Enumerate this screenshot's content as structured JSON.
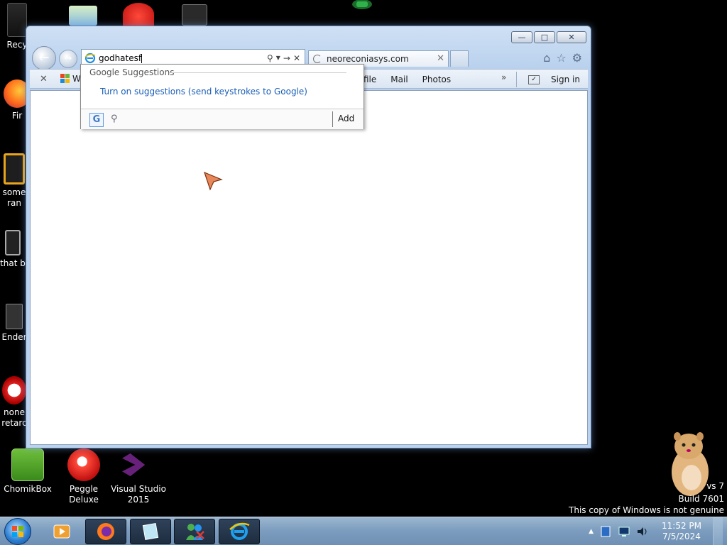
{
  "desktop": {
    "icons": [
      {
        "name": "recycle-bin",
        "label": "Recy"
      },
      {
        "name": "firefox",
        "label": "Fir"
      },
      {
        "name": "some-file",
        "label1": "some",
        "label2": "ran"
      },
      {
        "name": "that-b-file",
        "label": "that b"
      },
      {
        "name": "ender-file",
        "label": "Ender"
      },
      {
        "name": "none-retard-file",
        "label1": "none",
        "label2": "retarc"
      },
      {
        "name": "chomikbox",
        "label": "ChomikBox"
      },
      {
        "name": "peggle-deluxe",
        "label": "Peggle Deluxe"
      },
      {
        "name": "visual-studio",
        "label1": "Visual Studio",
        "label2": "2015"
      }
    ],
    "watermark": {
      "line1": "vs 7",
      "line2": "Build 7601",
      "line3": "This copy of Windows is not genuine"
    }
  },
  "browser": {
    "address_value": "godhatesf",
    "tab_label": "neoreconiasys.com",
    "favorites_bar": {
      "windows_link": "W",
      "links": [
        "file",
        "Mail",
        "Photos"
      ],
      "sign_in": "Sign in"
    },
    "suggestions": {
      "header": "Google Suggestions",
      "turn_on": "Turn on suggestions (send keystrokes to Google)",
      "add_label": "Add",
      "provider_glyph": "G"
    }
  },
  "taskbar": {
    "clock_time": "11:52 PM",
    "clock_date": "7/5/2024"
  },
  "colors": {
    "link_blue": "#1b5fb8",
    "window_frame": "#bcd3ef",
    "taskbar": "#7b9cbe"
  }
}
